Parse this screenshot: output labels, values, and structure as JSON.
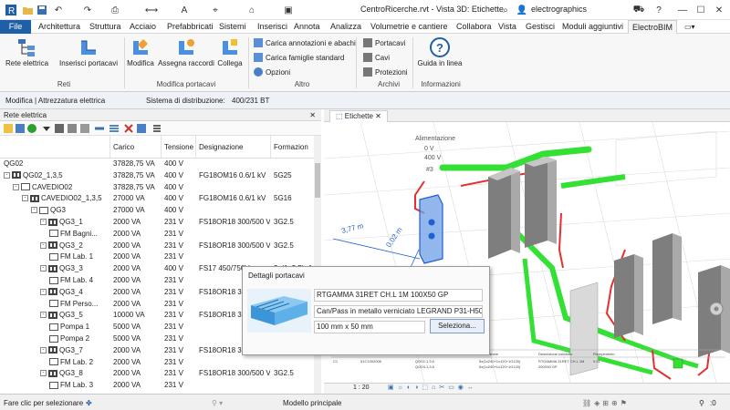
{
  "window": {
    "title": "CentroRicerche.rvt - Vista 3D: Etichette",
    "user": "electrographics"
  },
  "menu": {
    "file": "File",
    "tabs": [
      "Architettura",
      "Struttura",
      "Acciaio",
      "Prefabbricati",
      "Sistemi",
      "Inserisci",
      "Annota",
      "Analizza",
      "Volumetrie e cantiere",
      "Collabora",
      "Vista",
      "Gestisci",
      "Moduli aggiuntivi",
      "ElectroBIM"
    ],
    "active": "ElectroBIM"
  },
  "ribbon": {
    "reti": {
      "label": "Reti",
      "button": "Rete elettrica"
    },
    "portacavi": {
      "insert": "Inserisci portacavi"
    },
    "modifica": {
      "label": "Modifica portacavi",
      "buttons": [
        "Modifica",
        "Assegna raccordi",
        "Collega"
      ]
    },
    "altro": {
      "label": "Altro",
      "items": [
        "Carica annotazioni e abachi",
        "Carica famiglie standard",
        "Opzioni"
      ]
    },
    "archivi": {
      "label": "Archivi",
      "items": [
        "Portacavi",
        "Cavi",
        "Protezioni"
      ]
    },
    "info": {
      "label": "Informazioni",
      "button": "Guida in linea"
    }
  },
  "options_bar": {
    "context": "Modifica | Attrezzatura elettrica",
    "system_label": "Sistema di distribuzione:",
    "system_value": "400/231 BT"
  },
  "left_panel": {
    "title": "Rete elettrica",
    "columns": [
      "Carico",
      "Tensione",
      "Designazione",
      "Formazion"
    ],
    "rows": [
      {
        "name": "QG02",
        "carico": "37828,75 VA",
        "tensione": "400 V",
        "designazione": "",
        "formazione": "",
        "level": 0,
        "toggle": "",
        "icon": "none"
      },
      {
        "name": "QG02_1,3,5",
        "carico": "37828,75 VA",
        "tensione": "400 V",
        "designazione": "FG18OM16 0.6/1 kV",
        "formazione": "5G25",
        "level": 0,
        "toggle": "-",
        "icon": "panel"
      },
      {
        "name": "CAVEDIO02",
        "carico": "37828,75 VA",
        "tensione": "400 V",
        "designazione": "",
        "formazione": "",
        "level": 1,
        "toggle": "-",
        "icon": "box"
      },
      {
        "name": "CAVEDIO02_1,3,5",
        "carico": "27000 VA",
        "tensione": "400 V",
        "designazione": "FG18OM16 0.6/1 kV",
        "formazione": "5G16",
        "level": 2,
        "toggle": "-",
        "icon": "panel"
      },
      {
        "name": "QG3",
        "carico": "27000 VA",
        "tensione": "400 V",
        "designazione": "",
        "formazione": "",
        "level": 3,
        "toggle": "-",
        "icon": "box"
      },
      {
        "name": "QG3_1",
        "carico": "2000 VA",
        "tensione": "231 V",
        "designazione": "FS18OR18 300/500 V",
        "formazione": "3G2.5",
        "level": 4,
        "toggle": "-",
        "icon": "panel"
      },
      {
        "name": "FM Bagni...",
        "carico": "2000 VA",
        "tensione": "231 V",
        "designazione": "",
        "formazione": "",
        "level": 5,
        "toggle": "",
        "icon": "box"
      },
      {
        "name": "QG3_2",
        "carico": "2000 VA",
        "tensione": "231 V",
        "designazione": "FS18OR18 300/500 V",
        "formazione": "3G2.5",
        "level": 4,
        "toggle": "-",
        "icon": "panel"
      },
      {
        "name": "FM Lab. 1",
        "carico": "2000 VA",
        "tensione": "231 V",
        "designazione": "",
        "formazione": "",
        "level": 5,
        "toggle": "",
        "icon": "box"
      },
      {
        "name": "QG3_3",
        "carico": "2000 VA",
        "tensione": "400 V",
        "designazione": "FS17 450/750V",
        "formazione": "2x(1x2.5)+1",
        "level": 4,
        "toggle": "-",
        "icon": "panel"
      },
      {
        "name": "FM Lab. 4",
        "carico": "2000 VA",
        "tensione": "231 V",
        "designazione": "",
        "formazione": "",
        "level": 5,
        "toggle": "",
        "icon": "box"
      },
      {
        "name": "QG3_4",
        "carico": "2000 VA",
        "tensione": "231 V",
        "designazione": "FS18OR18 30",
        "formazione": "",
        "level": 4,
        "toggle": "-",
        "icon": "panel"
      },
      {
        "name": "FM Perso...",
        "carico": "2000 VA",
        "tensione": "231 V",
        "designazione": "",
        "formazione": "",
        "level": 5,
        "toggle": "",
        "icon": "box"
      },
      {
        "name": "QG3_5",
        "carico": "10000 VA",
        "tensione": "231 V",
        "designazione": "FS18OR18 30",
        "formazione": "",
        "level": 4,
        "toggle": "-",
        "icon": "panel"
      },
      {
        "name": "Pompa 1",
        "carico": "5000 VA",
        "tensione": "231 V",
        "designazione": "",
        "formazione": "",
        "level": 5,
        "toggle": "",
        "icon": "box"
      },
      {
        "name": "Pompa 2",
        "carico": "5000 VA",
        "tensione": "231 V",
        "designazione": "",
        "formazione": "",
        "level": 5,
        "toggle": "",
        "icon": "box"
      },
      {
        "name": "QG3_7",
        "carico": "2000 VA",
        "tensione": "231 V",
        "designazione": "FS18OR18 30",
        "formazione": "",
        "level": 4,
        "toggle": "-",
        "icon": "panel"
      },
      {
        "name": "FM Lab. 2",
        "carico": "2000 VA",
        "tensione": "231 V",
        "designazione": "",
        "formazione": "",
        "level": 5,
        "toggle": "",
        "icon": "box"
      },
      {
        "name": "QG3_8",
        "carico": "2000 VA",
        "tensione": "231 V",
        "designazione": "FS18OR18 300/500 V",
        "formazione": "3G2.5",
        "level": 4,
        "toggle": "-",
        "icon": "panel"
      },
      {
        "name": "FM Lab. 3",
        "carico": "2000 VA",
        "tensione": "231 V",
        "designazione": "",
        "formazione": "",
        "level": 5,
        "toggle": "",
        "icon": "box"
      }
    ]
  },
  "view": {
    "tab": "Etichette",
    "label_alimentazione": "Alimentazione",
    "label_v1": "0 V",
    "label_v2": "400 V",
    "label_num": "#3",
    "dim1": "3,77 m",
    "dim2": "0,02 m",
    "scale": "1 : 20",
    "schedule_headers": [
      "Condotto",
      "Codice condotto",
      "Utenze",
      "Formazione",
      "Descrizione condotto",
      "Riempimento",
      "Sbarra",
      "Tipo"
    ],
    "schedule_row1": [
      "C1",
      "51C1002006",
      "QG02-1,3,5",
      "5x(1x240+1x120+1G120)",
      "RTGAMMA 31RET CH.L 1M",
      "0.51"
    ],
    "schedule_row2": [
      "",
      "",
      "QG03-1,3,5",
      "5x(1x240+1x120+1G120)",
      "200X50 GP",
      ""
    ]
  },
  "popup": {
    "title": "Dettagli portacavi",
    "code": "RTGAMMA 31RET CH.L 1M 100X50 GP",
    "desc": "Can/Pass in metallo verniciato LEGRAND P31-H50-",
    "size": "100 mm x 50 mm",
    "button": "Seleziona..."
  },
  "status": {
    "hint": "Fare clic per selezionare",
    "model": "Modello principale",
    "counter": ":0"
  },
  "colors": {
    "file_tab": "#1f5fa8",
    "tray_green": "#33e033",
    "cable_red": "#e53030",
    "selection_blue": "#3f7fe0"
  }
}
